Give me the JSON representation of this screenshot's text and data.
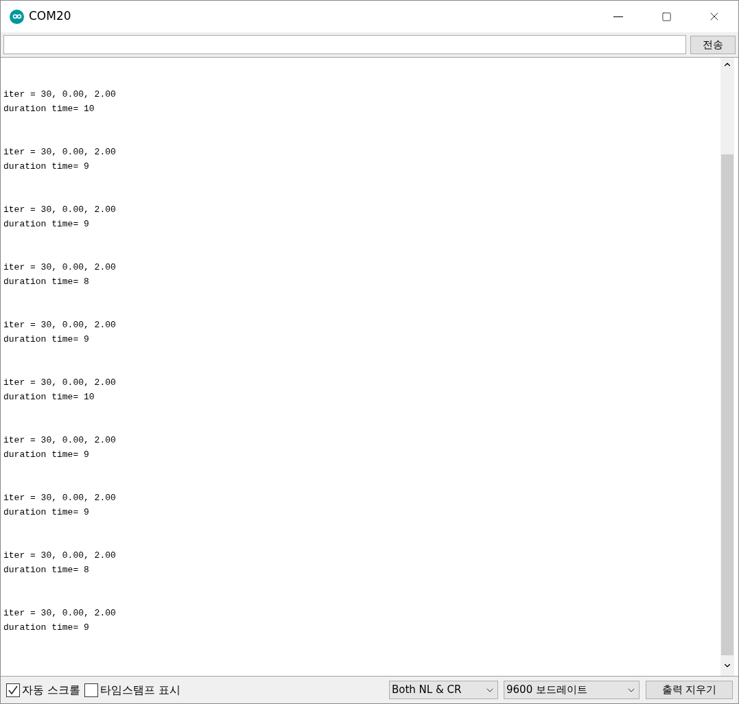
{
  "window": {
    "title": "COM20"
  },
  "send_button": "전송",
  "output": [
    {
      "iter": "iter = 30, 0.00, 2.00",
      "duration": "duration time= 10"
    },
    {
      "iter": "iter = 30, 0.00, 2.00",
      "duration": "duration time= 9"
    },
    {
      "iter": "iter = 30, 0.00, 2.00",
      "duration": "duration time= 9"
    },
    {
      "iter": "iter = 30, 0.00, 2.00",
      "duration": "duration time= 8"
    },
    {
      "iter": "iter = 30, 0.00, 2.00",
      "duration": "duration time= 9"
    },
    {
      "iter": "iter = 30, 0.00, 2.00",
      "duration": "duration time= 10"
    },
    {
      "iter": "iter = 30, 0.00, 2.00",
      "duration": "duration time= 9"
    },
    {
      "iter": "iter = 30, 0.00, 2.00",
      "duration": "duration time= 9"
    },
    {
      "iter": "iter = 30, 0.00, 2.00",
      "duration": "duration time= 8"
    },
    {
      "iter": "iter = 30, 0.00, 2.00",
      "duration": "duration time= 9"
    }
  ],
  "status_bar": {
    "checkboxes": [
      {
        "label": "자동 스크롤",
        "checked": true
      },
      {
        "label": "타임스탬프 표시",
        "checked": false
      }
    ],
    "line_ending": "Both NL & CR",
    "baud_rate": "9600 보드레이트",
    "clear_button": "출력 지우기"
  }
}
